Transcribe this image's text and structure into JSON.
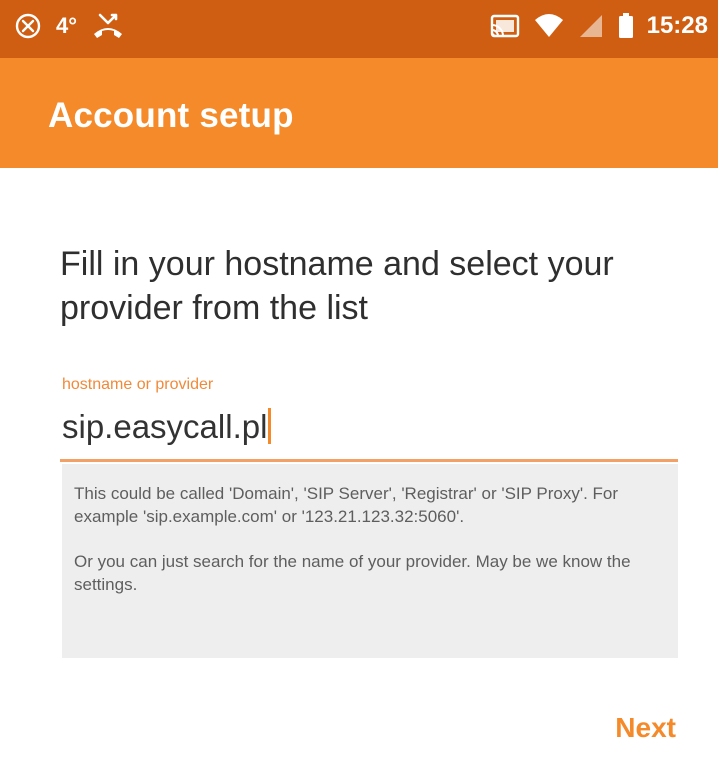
{
  "status_bar": {
    "temperature": "4°",
    "time": "15:28",
    "icons": [
      "cancel-circle-icon",
      "missed-call-icon",
      "cast-icon",
      "wifi-icon",
      "cellular-signal-icon",
      "battery-icon"
    ]
  },
  "app_bar": {
    "title": "Account setup"
  },
  "main": {
    "instruction": "Fill in your hostname and select your provider from the list",
    "field": {
      "label": "hostname or provider",
      "value": "sip.easycall.pl"
    },
    "help": {
      "paragraph1": "This could be called 'Domain', 'SIP Server', 'Registrar' or 'SIP Proxy'. For example 'sip.example.com' or '123.21.123.32:5060'.",
      "paragraph2": "Or you can just search for the name of your provider. May be we know the settings."
    }
  },
  "actions": {
    "next_label": "Next"
  },
  "colors": {
    "status_bar": "#cf5e12",
    "app_bar": "#f58a2a",
    "accent": "#f58a2a",
    "help_bg": "#eeeeee"
  }
}
